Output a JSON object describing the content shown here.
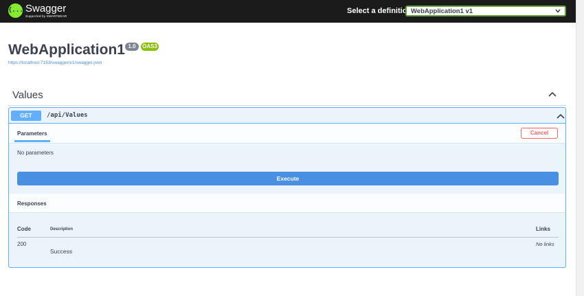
{
  "topbar": {
    "logo_title": "Swagger",
    "logo_subtitle": "Supported by SMARTBEAR",
    "logo_glyph": "{...}",
    "definition_label": "Select a definition",
    "definition_selected": "WebApplication1 v1"
  },
  "info": {
    "title": "WebApplication1",
    "version": "1.0",
    "oas_badge": "OAS3",
    "spec_url": "https://localhost:7153/swagger/v1/swagger.json"
  },
  "tag": {
    "name": "Values"
  },
  "operation": {
    "method": "GET",
    "path": "/api/Values",
    "parameters_tab": "Parameters",
    "cancel_label": "Cancel",
    "no_parameters": "No parameters",
    "execute_label": "Execute",
    "responses_title": "Responses",
    "columns": {
      "code": "Code",
      "description": "Description",
      "links": "Links"
    },
    "responses": [
      {
        "code": "200",
        "description": "Success",
        "links": "No links"
      }
    ]
  },
  "colors": {
    "topbar_bg": "#1b1b1b",
    "get_accent": "#61affe",
    "execute_blue": "#4990e2",
    "cancel_red": "#ff6060",
    "oas_green": "#89bf04",
    "version_gray": "#7d8492",
    "logo_green": "#85ea2d"
  },
  "icons": {
    "definition_dropdown": "chevron-down-icon",
    "tag_toggle": "chevron-up-icon",
    "operation_toggle": "chevron-up-icon"
  }
}
